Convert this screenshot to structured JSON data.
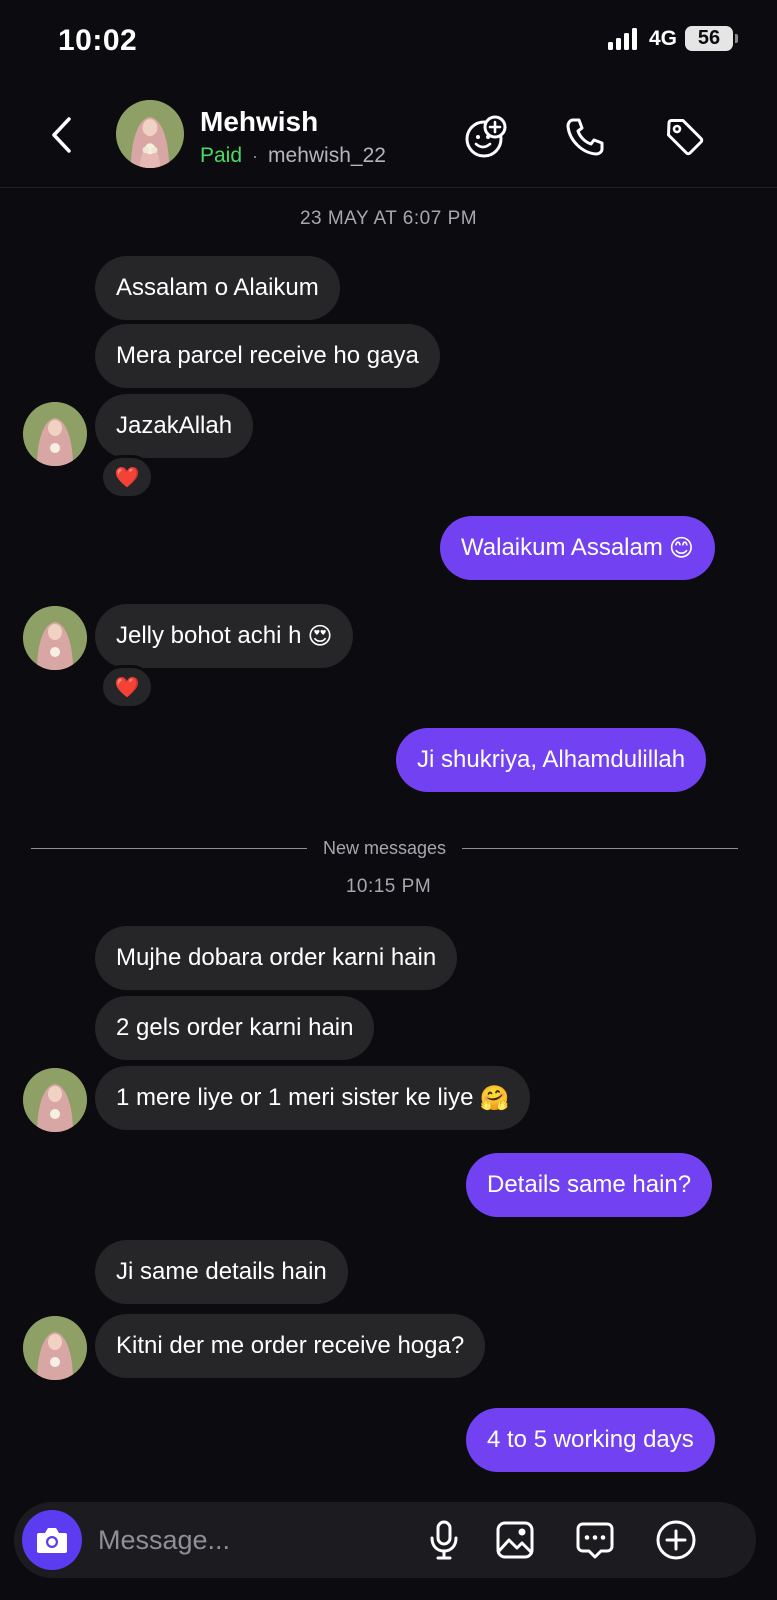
{
  "status_bar": {
    "time": "10:02",
    "network": "4G",
    "battery": "56"
  },
  "header": {
    "contact_name": "Mehwish",
    "status": "Paid",
    "separator": "·",
    "username": "mehwish_22",
    "icons": [
      "chevron-left-icon",
      "add-sticker-icon",
      "phone-icon",
      "tag-icon"
    ]
  },
  "conversation": {
    "timestamp_1": "23 MAY AT 6:07 PM",
    "msg_1": "Assalam o Alaikum",
    "msg_2": "Mera parcel receive ho gaya",
    "msg_3": "JazakAllah",
    "reaction_1": "❤️",
    "msg_4": "Walaikum Assalam",
    "msg_4_emoji": "😊",
    "msg_5": "Jelly bohot achi h",
    "msg_5_emoji": "😍",
    "reaction_2": "❤️",
    "msg_6": "Ji shukriya, Alhamdulillah",
    "new_messages_label": "New messages",
    "timestamp_2": "10:15 PM",
    "msg_7": "Mujhe dobara order karni hain",
    "msg_8": "2 gels order karni hain",
    "msg_9": "1 mere liye or 1 meri sister ke liye",
    "msg_9_emoji": "🤗",
    "msg_10": "Details same hain?",
    "msg_11": "Ji same details hain",
    "msg_12": "Kitni der me order receive hoga?",
    "msg_13": "4 to 5 working days"
  },
  "composer": {
    "placeholder": "Message...",
    "icons": [
      "camera-icon",
      "microphone-icon",
      "gallery-icon",
      "chat-options-icon",
      "plus-circle-icon"
    ]
  },
  "colors": {
    "background": "#0b0b10",
    "incoming_bubble": "#262629",
    "outgoing_bubble": "#7241f2",
    "paid_green": "#4cd964",
    "camera_button": "#5b3cf0"
  }
}
